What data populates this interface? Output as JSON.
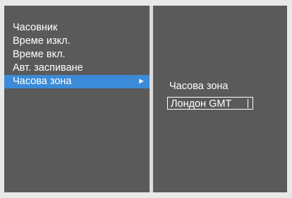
{
  "menu": {
    "items": [
      {
        "label": "Часовник"
      },
      {
        "label": "Време изкл."
      },
      {
        "label": "Време вкл."
      },
      {
        "label": "Авт. заспиване"
      },
      {
        "label": "Часова зона",
        "selected": true,
        "arrow": "►"
      }
    ]
  },
  "submenu": {
    "title": "Часова зона",
    "value": "Лондон GMT"
  },
  "colors": {
    "panel_bg": "#5a5a5a",
    "highlight": "#3b8bd8",
    "text": "#ffffff"
  },
  "icons": {
    "submenu_arrow": "right-triangle-icon"
  }
}
